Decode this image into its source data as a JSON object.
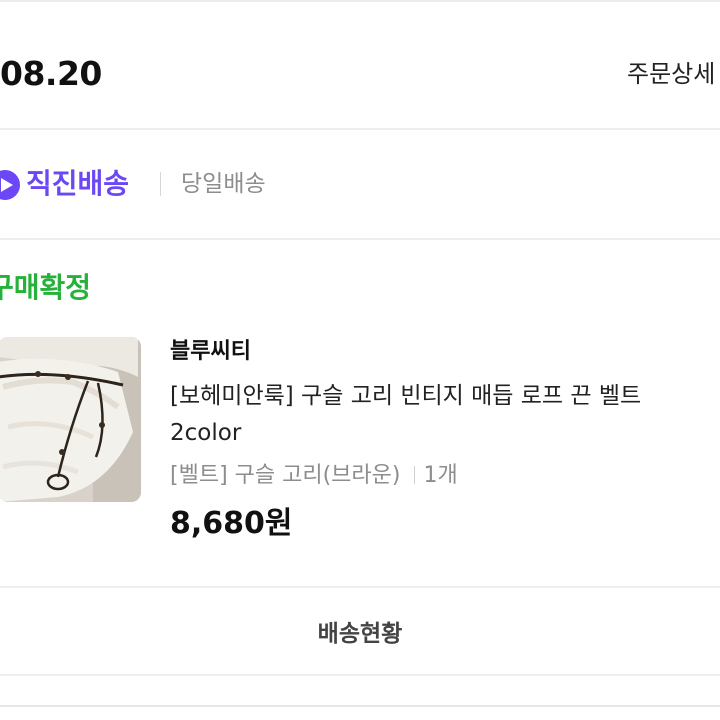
{
  "header": {
    "order_date": "08.20",
    "order_detail_link": "주문상세"
  },
  "delivery": {
    "direct_label": "직진배송",
    "sameday_label": "당일배송"
  },
  "order_item": {
    "status": "구매확정",
    "brand": "블루씨티",
    "name_line1": "[보헤미안룩] 구슬 고리 빈티지 매듭 로프 끈 벨트",
    "name_line2": "2color",
    "option": "[벨트] 구슬 고리(브라운)",
    "quantity": "1개",
    "price": "8,680원"
  },
  "actions": {
    "tracking_label": "배송현황"
  },
  "colors": {
    "accent_purple": "#6b47f5",
    "status_green": "#25b13a",
    "muted_gray": "#8d8d8d"
  }
}
